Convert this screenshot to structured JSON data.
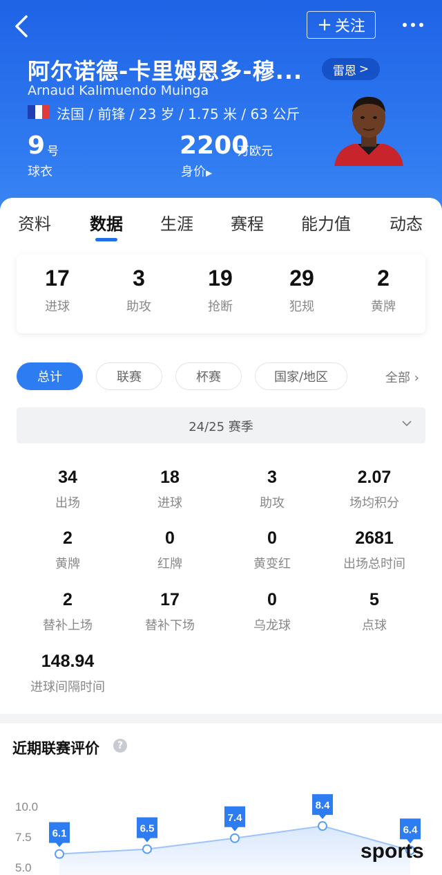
{
  "header": {
    "follow_label": "关注",
    "player_name": "阿尔诺德-卡里姆恩多-穆...",
    "english_name": "Arnaud Kalimuendo Muinga",
    "info_line": "法国 / 前锋 / 23 岁 / 1.75 米 / 63 公斤",
    "team_label": "雷恩",
    "jersey_number": "9",
    "jersey_unit": "号",
    "jersey_label": "球衣",
    "market_value": "2200",
    "market_value_unit": "万欧元",
    "market_value_label": "身价"
  },
  "tabs": [
    "资料",
    "数据",
    "生涯",
    "赛程",
    "能力值",
    "动态"
  ],
  "active_tab": "数据",
  "summary": [
    {
      "value": "17",
      "label": "进球"
    },
    {
      "value": "3",
      "label": "助攻"
    },
    {
      "value": "19",
      "label": "抢断"
    },
    {
      "value": "29",
      "label": "犯规"
    },
    {
      "value": "2",
      "label": "黄牌"
    }
  ],
  "filters": [
    "总计",
    "联赛",
    "杯赛",
    "国家/地区"
  ],
  "filter_all": "全部",
  "season": "24/25 赛季",
  "stats": [
    {
      "value": "34",
      "label": "出场"
    },
    {
      "value": "18",
      "label": "进球"
    },
    {
      "value": "3",
      "label": "助攻"
    },
    {
      "value": "2.07",
      "label": "场均积分"
    },
    {
      "value": "2",
      "label": "黄牌"
    },
    {
      "value": "0",
      "label": "红牌"
    },
    {
      "value": "0",
      "label": "黄变红"
    },
    {
      "value": "2681",
      "label": "出场总时间"
    },
    {
      "value": "2",
      "label": "替补上场"
    },
    {
      "value": "17",
      "label": "替补下场"
    },
    {
      "value": "0",
      "label": "乌龙球"
    },
    {
      "value": "5",
      "label": "点球"
    },
    {
      "value": "148.94",
      "label": "进球间隔时间"
    }
  ],
  "rating_title": "近期联赛评价",
  "chart_data": {
    "type": "line",
    "title": "",
    "y_ticks": [
      "10.0",
      "7.5",
      "5.0"
    ],
    "ylim": [
      5.0,
      10.0
    ],
    "values": [
      6.1,
      6.5,
      7.4,
      8.4,
      6.4
    ],
    "labels": [
      "6.1",
      "6.5",
      "7.4",
      "8.4",
      "6.4"
    ]
  },
  "watermark": "sports",
  "colors": {
    "accent": "#2d7cf2",
    "header": "#1f63e6"
  }
}
